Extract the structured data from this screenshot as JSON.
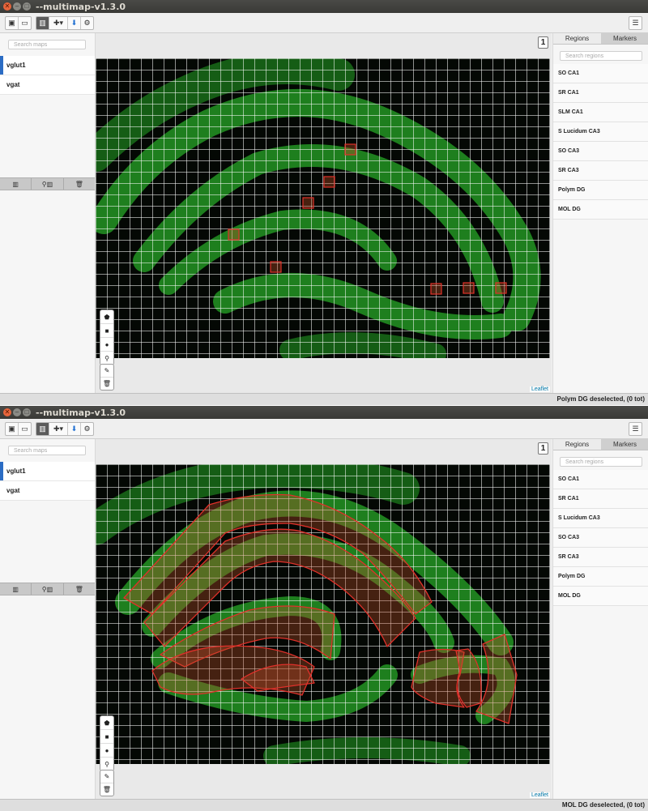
{
  "windows": [
    {
      "title": "--multimap-v1.3.0",
      "search_maps_placeholder": "Search maps",
      "maps": [
        "vglut1",
        "vgat"
      ],
      "page_number": "1",
      "tabs": [
        "Regions",
        "Markers"
      ],
      "search_regions_placeholder": "Search regions",
      "regions": [
        "SO CA1",
        "SR CA1",
        "SLM CA1",
        "S Lucidum CA3",
        "SO CA3",
        "SR CA3",
        "Polym DG",
        "MOL DG"
      ],
      "attribution": "Leaflet",
      "status": "Polym DG deselected, (0 tot)"
    },
    {
      "title": "--multimap-v1.3.0",
      "search_maps_placeholder": "Search maps",
      "maps": [
        "vglut1",
        "vgat"
      ],
      "page_number": "1",
      "tabs": [
        "Regions",
        "Markers"
      ],
      "search_regions_placeholder": "Search regions",
      "regions": [
        "SO CA1",
        "SR CA1",
        "S Lucidum CA3",
        "SO CA3",
        "SR CA3",
        "Polym DG",
        "MOL DG"
      ],
      "attribution": "Leaflet",
      "status": "MOL DG deselected, (0 tot)"
    }
  ],
  "icons": {
    "close": "close-icon",
    "minimize": "minimize-icon",
    "maximize": "maximize-icon",
    "save": "save-icon",
    "open": "folder-icon",
    "map": "map-icon",
    "add": "plus-icon",
    "download": "download-arrow-icon",
    "settings": "gear-icon",
    "menu": "hamburger-icon",
    "polygon": "pentagon-icon",
    "rectangle": "square-icon",
    "circle": "circle-icon",
    "marker": "map-marker-icon",
    "edit": "edit-icon",
    "delete": "trash-icon"
  },
  "colors": {
    "accent": "#2b6cc4",
    "tissue": "#1f8a1f",
    "region_stroke": "#e0302a",
    "region_fill": "#c0502a"
  }
}
